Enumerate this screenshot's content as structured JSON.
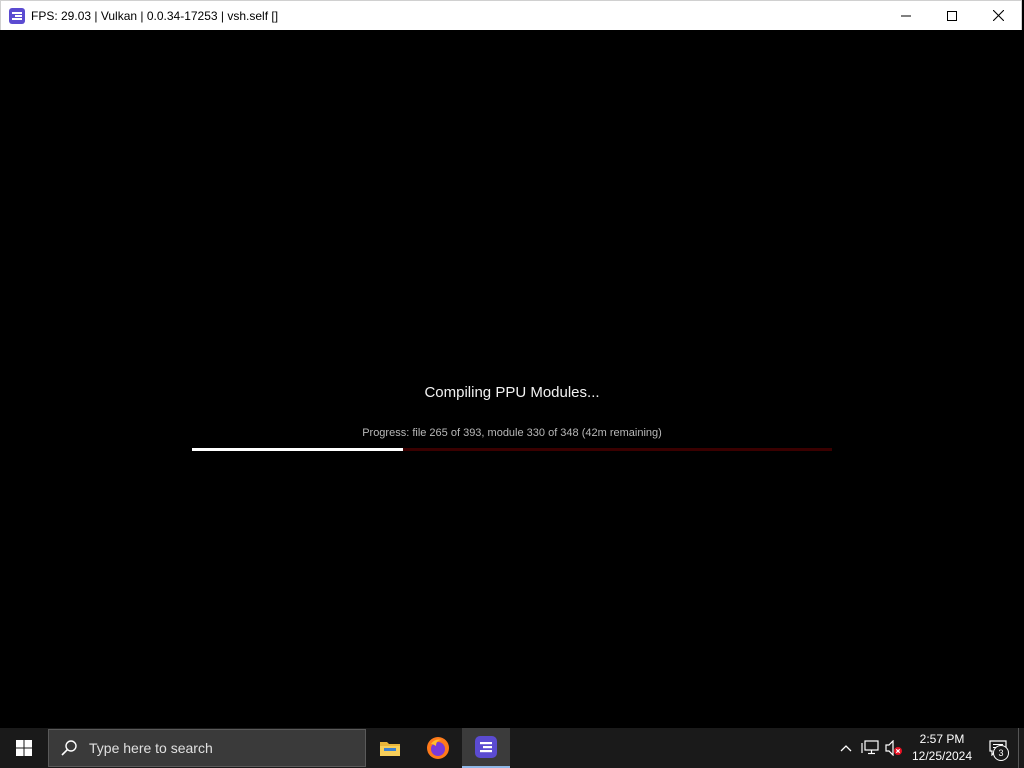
{
  "window": {
    "title": "FPS: 29.03 | Vulkan | 0.0.34-17253 | vsh.self []"
  },
  "compile": {
    "title": "Compiling PPU Modules...",
    "progress_text": "Progress: file 265 of 393, module 330 of 348 (42m remaining)",
    "progress_fraction": 0.33
  },
  "taskbar": {
    "search_placeholder": "Type here to search",
    "apps": [
      "file-explorer",
      "firefox",
      "rpcs3"
    ],
    "clock_time": "2:57 PM",
    "clock_date": "12/25/2024",
    "notification_count": "3"
  },
  "colors": {
    "app_icon": "#5b4bd1",
    "progress_fill": "#ffffff",
    "progress_track": "#3a0000",
    "taskbar_bg": "#1a1a1a"
  }
}
